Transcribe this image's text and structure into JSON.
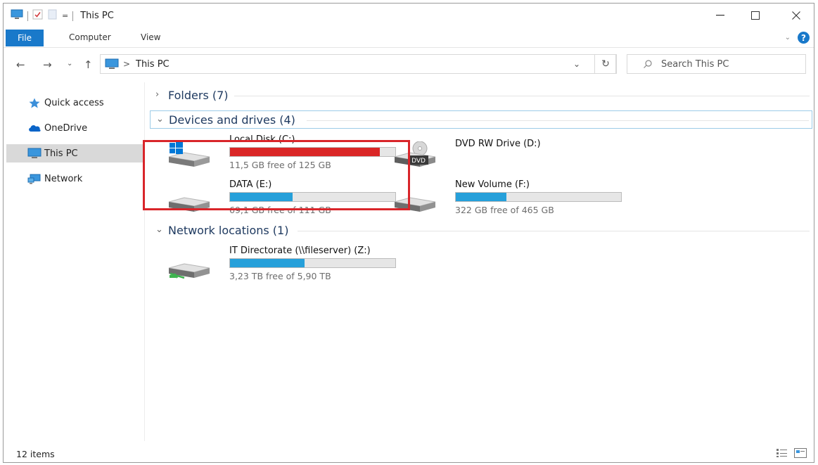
{
  "window": {
    "title": "This PC",
    "qat_dropdown_glyph": "="
  },
  "ribbon": {
    "tabs": [
      {
        "label": "File",
        "active": true
      },
      {
        "label": "Computer"
      },
      {
        "label": "View"
      }
    ],
    "expand_icon": "chevron-down-icon",
    "help_label": "?"
  },
  "address": {
    "breadcrumb": [
      "This PC"
    ],
    "crumb_separator": ">",
    "search_placeholder": "Search This PC"
  },
  "nav_pane": {
    "items": [
      {
        "label": "Quick access",
        "icon": "star-icon"
      },
      {
        "label": "OneDrive",
        "icon": "cloud-icon"
      },
      {
        "label": "This PC",
        "icon": "computer-icon",
        "selected": true
      },
      {
        "label": "Network",
        "icon": "network-icon"
      }
    ]
  },
  "groups": {
    "folders": {
      "title": "Folders (7)",
      "expanded": false
    },
    "devices": {
      "title": "Devices and drives (4)",
      "expanded": true,
      "drives": [
        {
          "name": "Local Disk (C:)",
          "free_text": "11,5 GB free of 125 GB",
          "used_fraction": 0.908,
          "bar_color": "#da2626",
          "icon": "windows-drive-icon"
        },
        {
          "name": "DVD RW Drive (D:)",
          "free_text": "",
          "icon": "dvd-drive-icon",
          "dvd_label": "DVD"
        },
        {
          "name": "DATA (E:)",
          "free_text": "69,1 GB free of 111 GB",
          "used_fraction": 0.377,
          "bar_color": "#26a0da",
          "icon": "hard-drive-icon"
        },
        {
          "name": "New Volume (F:)",
          "free_text": "322 GB free of 465 GB",
          "used_fraction": 0.308,
          "bar_color": "#26a0da",
          "icon": "hard-drive-icon"
        }
      ]
    },
    "network": {
      "title": "Network locations (1)",
      "expanded": true,
      "drives": [
        {
          "name": "IT Directorate (\\\\fileserver) (Z:)",
          "free_text": "3,23 TB free of 5,90 TB",
          "used_fraction": 0.453,
          "bar_color": "#26a0da",
          "icon": "network-drive-icon"
        }
      ]
    }
  },
  "status": {
    "item_count": "12 items"
  },
  "colors": {
    "accent": "#1979ca",
    "drive_bar_normal": "#26a0da",
    "drive_bar_full": "#da2626",
    "highlight_box": "#d9252a"
  }
}
